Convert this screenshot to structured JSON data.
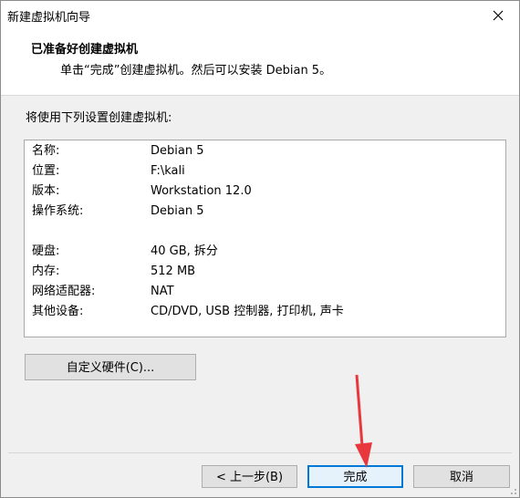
{
  "window": {
    "title": "新建虚拟机向导"
  },
  "header": {
    "title": "已准备好创建虚拟机",
    "subtitle": "单击“完成”创建虚拟机。然后可以安装 Debian 5。"
  },
  "intro": "将使用下列设置创建虚拟机:",
  "summary": [
    {
      "label": "名称:",
      "value": "Debian 5"
    },
    {
      "label": "位置:",
      "value": "F:\\kali"
    },
    {
      "label": "版本:",
      "value": "Workstation 12.0"
    },
    {
      "label": "操作系统:",
      "value": "Debian 5"
    },
    {
      "label": "硬盘:",
      "value": "40 GB, 拆分"
    },
    {
      "label": "内存:",
      "value": "512 MB"
    },
    {
      "label": "网络适配器:",
      "value": "NAT"
    },
    {
      "label": "其他设备:",
      "value": "CD/DVD, USB 控制器, 打印机, 声卡"
    }
  ],
  "buttons": {
    "customize_label": "自定义硬件(C)...",
    "back_label": "< 上一步(B)",
    "finish_label": "完成",
    "cancel_label": "取消"
  },
  "colors": {
    "accent": "#0078d7",
    "arrow": "#e8383d"
  },
  "icons": {
    "close": "close-icon",
    "pointer": "red-arrow-annotation"
  }
}
